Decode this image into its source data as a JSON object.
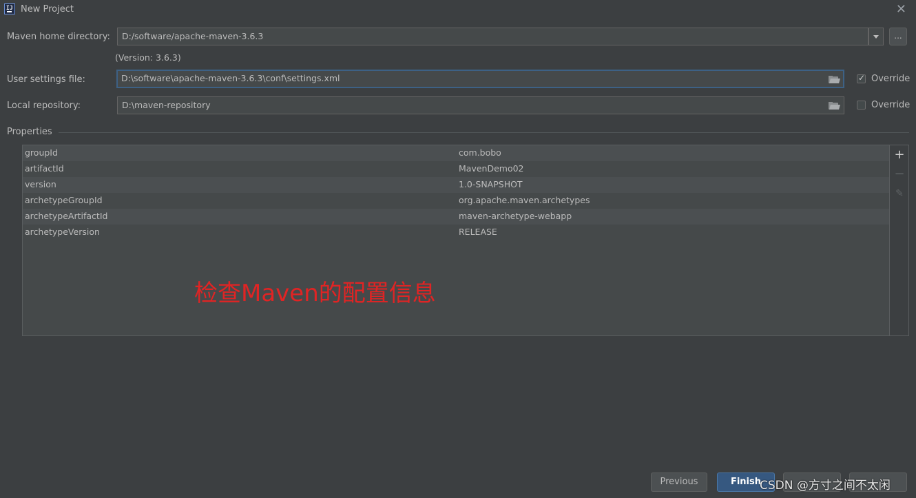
{
  "window": {
    "title": "New Project",
    "icon_text": "IJ"
  },
  "maven": {
    "home_label": "Maven home directory:",
    "home_value": "D:/software/apache-maven-3.6.3",
    "browse_label": "...",
    "version_note": "(Version: 3.6.3)",
    "settings_label": "User settings file:",
    "settings_value": "D:\\software\\apache-maven-3.6.3\\conf\\settings.xml",
    "settings_override_label": "Override",
    "settings_override_checked": true,
    "repo_label": "Local repository:",
    "repo_value": "D:\\maven-repository",
    "repo_override_label": "Override",
    "repo_override_checked": false
  },
  "properties": {
    "section_title": "Properties",
    "rows": [
      {
        "key": "groupId",
        "value": "com.bobo"
      },
      {
        "key": "artifactId",
        "value": "MavenDemo02"
      },
      {
        "key": "version",
        "value": "1.0-SNAPSHOT"
      },
      {
        "key": "archetypeGroupId",
        "value": "org.apache.maven.archetypes"
      },
      {
        "key": "archetypeArtifactId",
        "value": "maven-archetype-webapp"
      },
      {
        "key": "archetypeVersion",
        "value": "RELEASE"
      }
    ],
    "tools": {
      "add": "+",
      "remove": "−"
    }
  },
  "annotation": "检查Maven的配置信息",
  "footer": {
    "previous_label": "Previous",
    "finish_label": "Finish",
    "watermark": "CSDN @方寸之间不太闲"
  }
}
